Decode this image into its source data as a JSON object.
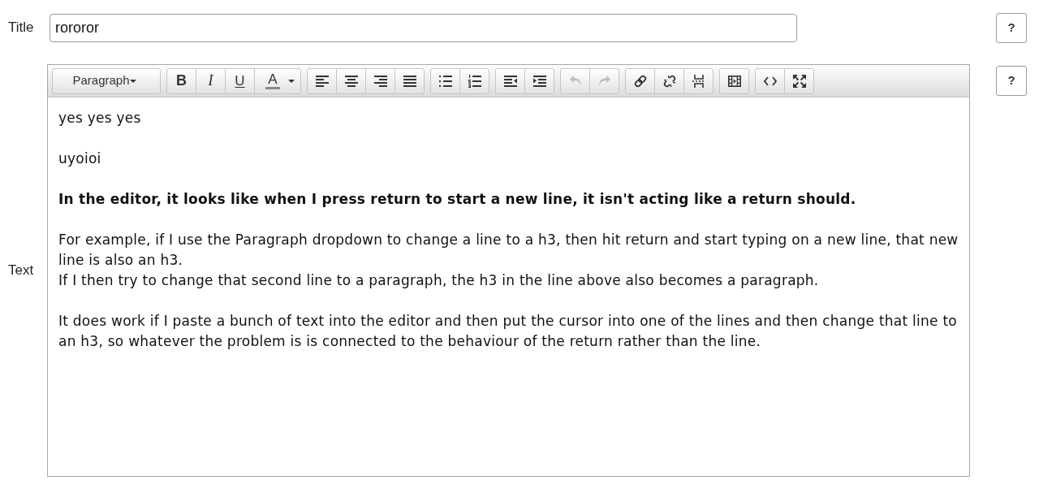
{
  "title_field": {
    "label": "Title",
    "value": "rororor",
    "help_button": "?"
  },
  "text_field": {
    "label": "Text",
    "help_button": "?",
    "toolbar": {
      "groups": [
        {
          "buttons": [
            {
              "kind": "format-select",
              "label": "Paragraph",
              "disabled": false
            }
          ]
        },
        {
          "buttons": [
            {
              "kind": "bold",
              "label": "B",
              "disabled": false
            },
            {
              "kind": "italic",
              "label": "I",
              "disabled": false
            },
            {
              "kind": "underline",
              "label": "U",
              "disabled": false
            },
            {
              "kind": "text-color",
              "label": "A",
              "disabled": false
            }
          ]
        },
        {
          "buttons": [
            {
              "kind": "align-left",
              "disabled": false
            },
            {
              "kind": "align-center",
              "disabled": false
            },
            {
              "kind": "align-right",
              "disabled": false
            },
            {
              "kind": "justify",
              "disabled": false
            }
          ]
        },
        {
          "buttons": [
            {
              "kind": "bullet-list",
              "disabled": false
            },
            {
              "kind": "numbered-list",
              "disabled": false
            }
          ]
        },
        {
          "buttons": [
            {
              "kind": "outdent",
              "disabled": false
            },
            {
              "kind": "indent",
              "disabled": false
            }
          ]
        },
        {
          "buttons": [
            {
              "kind": "undo",
              "disabled": true
            },
            {
              "kind": "redo",
              "disabled": true
            }
          ]
        },
        {
          "buttons": [
            {
              "kind": "link",
              "disabled": false
            },
            {
              "kind": "unlink",
              "disabled": false
            },
            {
              "kind": "page-break",
              "disabled": false
            }
          ]
        },
        {
          "buttons": [
            {
              "kind": "media",
              "disabled": false
            }
          ]
        },
        {
          "buttons": [
            {
              "kind": "source-code",
              "disabled": false
            },
            {
              "kind": "fullscreen",
              "disabled": false
            }
          ]
        }
      ]
    },
    "content": [
      {
        "kind": "normal",
        "lines": [
          "yes yes yes"
        ]
      },
      {
        "kind": "normal",
        "lines": [
          "uyoioi"
        ]
      },
      {
        "kind": "bold",
        "lines": [
          "In the editor, it looks like when I press return to start a new line, it isn't acting like a return should."
        ]
      },
      {
        "kind": "normal",
        "lines": [
          "For example, if I use the Paragraph dropdown to change a line to a h3, then hit return and start typing on a new line, that new line is also an h3.",
          "If I then try to change that second line to a paragraph, the h3 in the line above also becomes a paragraph."
        ]
      },
      {
        "kind": "normal",
        "lines": [
          "It does work if I paste a bunch of text into the editor and then put the cursor into one of the lines and then change that line to an h3, so whatever the problem is is connected to the behaviour of the return rather than the line."
        ]
      }
    ]
  }
}
